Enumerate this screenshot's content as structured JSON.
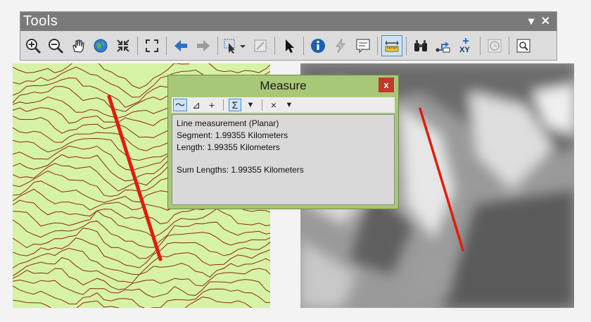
{
  "tools_window": {
    "title": "Tools",
    "dropdown_glyph": "▾",
    "close_glyph": "✕",
    "buttons": [
      {
        "name": "zoom-in-icon"
      },
      {
        "name": "zoom-out-icon"
      },
      {
        "name": "pan-hand-icon"
      },
      {
        "name": "full-extent-globe-icon"
      },
      {
        "name": "fixed-zoom-in-icon"
      },
      {
        "name": "fixed-zoom-out-icon"
      },
      {
        "name": "back-arrow-icon"
      },
      {
        "name": "forward-arrow-icon"
      },
      {
        "name": "select-features-icon"
      },
      {
        "name": "clear-selection-icon"
      },
      {
        "name": "select-elements-pointer-icon"
      },
      {
        "name": "identify-info-icon"
      },
      {
        "name": "hyperlink-lightning-icon"
      },
      {
        "name": "html-popup-icon"
      },
      {
        "name": "measure-ruler-icon"
      },
      {
        "name": "find-binoculars-icon"
      },
      {
        "name": "find-route-icon"
      },
      {
        "name": "go-to-xy-icon"
      },
      {
        "name": "time-slider-icon"
      },
      {
        "name": "magnifier-window-icon"
      }
    ]
  },
  "measure_dialog": {
    "title": "Measure",
    "close_glyph": "x",
    "toolbar": {
      "measure_line_glyph": "〜",
      "measure_area_glyph": "⊿",
      "measure_feature_glyph": "+",
      "sum_glyph": "Σ",
      "dropdown_glyph": "▼",
      "clear_glyph": "×",
      "units_dropdown_glyph": "▼"
    },
    "output": {
      "line1": "Line measurement (Planar)",
      "line2": "Segment: 1.99355 Kilometers",
      "line3": "Length: 1.99355 Kilometers",
      "line4": "Sum Lengths: 1.99355 Kilometers"
    }
  },
  "colors": {
    "measure_line": "#e41b0b",
    "contour_fill": "#d6f2a5",
    "contour_line": "#8b2a12",
    "dialog_frame": "#a8c777"
  }
}
